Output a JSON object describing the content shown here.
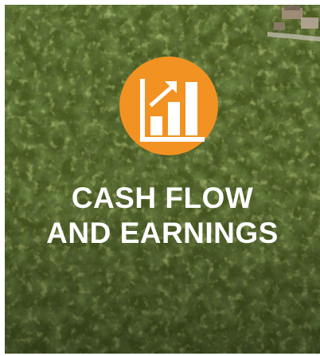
{
  "card": {
    "title_line1": "CASH FLOW",
    "title_line2": "AND EARNINGS",
    "icon": "bar-chart-growth-icon",
    "accent_color": "#f19222",
    "background": "aerial-forest-photo"
  }
}
